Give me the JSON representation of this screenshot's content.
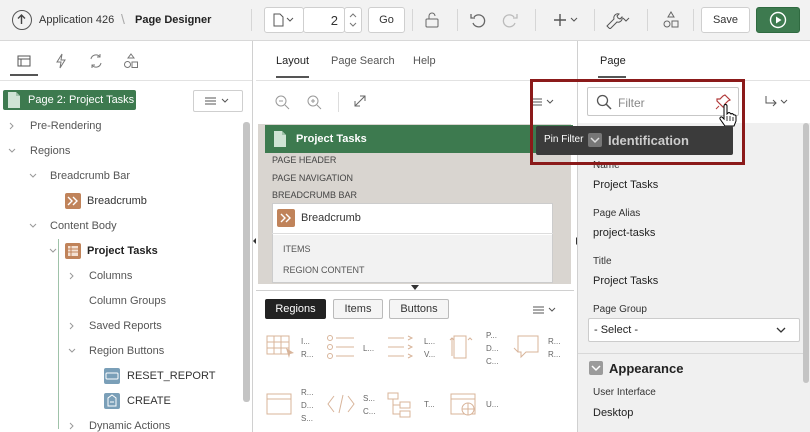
{
  "toolbar": {
    "app_label": "Application 426",
    "page_designer": "Page Designer",
    "page_number": "2",
    "go_label": "Go",
    "save_label": "Save"
  },
  "left": {
    "page_badge": "Page 2: Project Tasks",
    "tree": [
      {
        "label": "Pre-Rendering"
      },
      {
        "label": "Regions"
      },
      {
        "label": "Breadcrumb Bar"
      },
      {
        "label": "Breadcrumb"
      },
      {
        "label": "Content Body"
      },
      {
        "label": "Project Tasks"
      },
      {
        "label": "Columns"
      },
      {
        "label": "Column Groups"
      },
      {
        "label": "Saved Reports"
      },
      {
        "label": "Region Buttons"
      },
      {
        "label": "RESET_REPORT"
      },
      {
        "label": "CREATE"
      },
      {
        "label": "Dynamic Actions"
      }
    ]
  },
  "middle": {
    "tabs": [
      "Layout",
      "Page Search",
      "Help"
    ],
    "region_title": "Project Tasks",
    "positions": [
      "PAGE HEADER",
      "PAGE NAVIGATION",
      "BREADCRUMB BAR"
    ],
    "breadcrumb_title": "Breadcrumb",
    "items_label": "ITEMS",
    "region_content_label": "REGION CONTENT",
    "gallery_tabs": [
      "Regions",
      "Items",
      "Buttons"
    ],
    "gallery_row1": [
      [
        "I...",
        "R..."
      ],
      [
        "L..."
      ],
      [
        "L...",
        "V..."
      ],
      [
        "P...",
        "D...",
        "C..."
      ],
      [
        "R...",
        "R..."
      ]
    ],
    "gallery_row2": [
      [
        "R...",
        "D...",
        "S..."
      ],
      [
        "S...",
        "C..."
      ],
      [
        "T..."
      ],
      [
        "U..."
      ]
    ]
  },
  "right": {
    "tab": "Page",
    "filter_placeholder": "Filter",
    "tooltip": "Pin Filter",
    "identification": "Identification",
    "name_label": "Name",
    "name_value": "Project Tasks",
    "alias_label": "Page Alias",
    "alias_value": "project-tasks",
    "title_label": "Title",
    "title_value": "Project Tasks",
    "group_label": "Page Group",
    "group_value": "- Select -",
    "appearance": "Appearance",
    "ui_label": "User Interface",
    "ui_value": "Desktop"
  },
  "colors": {
    "accent_green": "#3d7a4f",
    "highlight_border": "#8b1a1a",
    "region_icon": "#c0835a"
  }
}
